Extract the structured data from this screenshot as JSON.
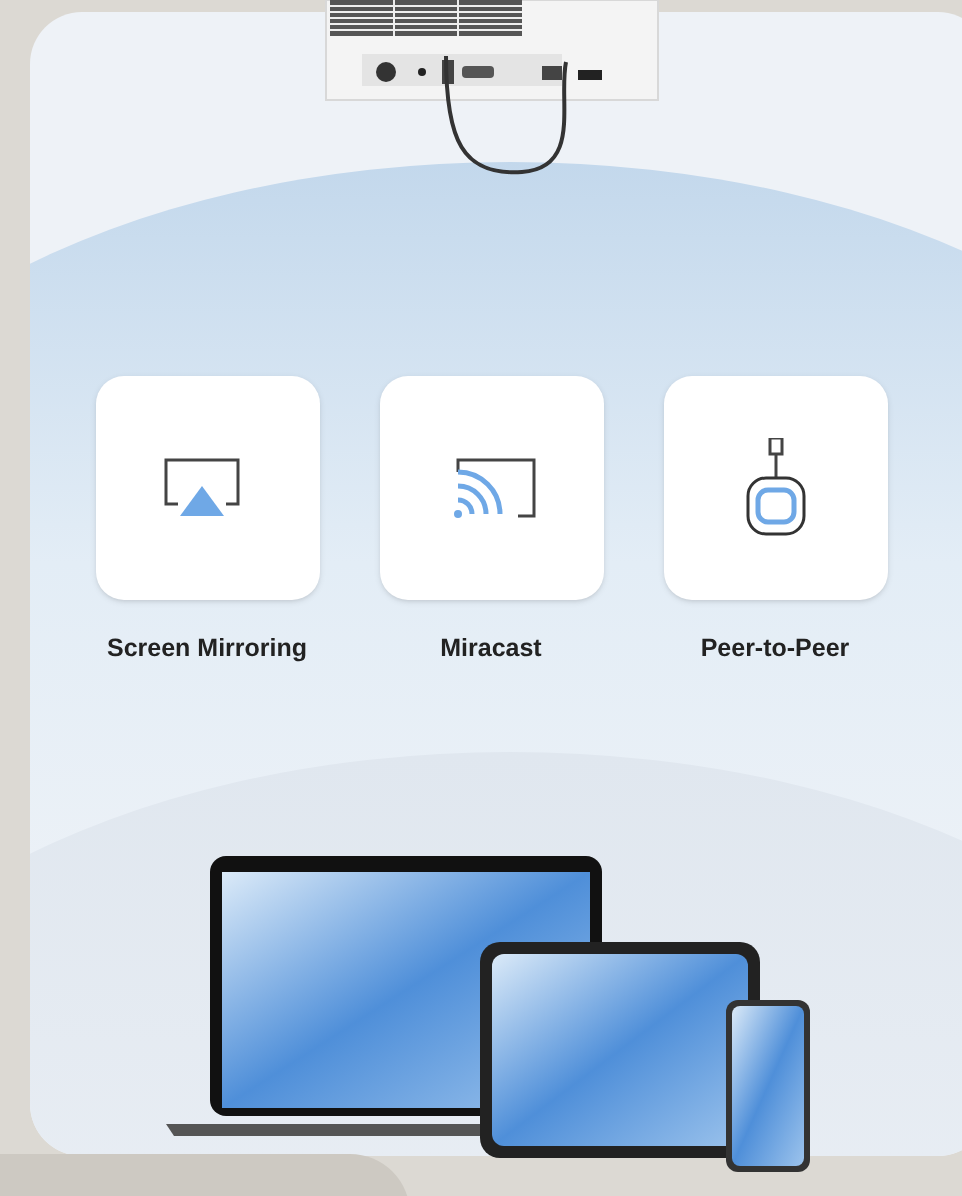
{
  "features": [
    {
      "label": "Screen Mirroring",
      "kind": "screen-cast"
    },
    {
      "label": "Miracast",
      "kind": "wireless-cast"
    },
    {
      "label": "Peer-to-Peer",
      "kind": "dongle"
    }
  ]
}
